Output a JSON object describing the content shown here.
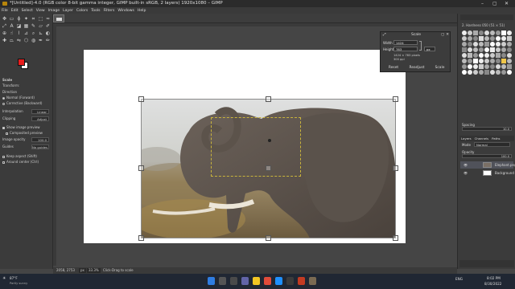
{
  "window": {
    "title": "*[Untitled]-4.0 (RGB color 8-bit gamma integer, GIMP built-in sRGB, 2 layers) 1920x1080 – GIMP"
  },
  "menu": [
    "File",
    "Edit",
    "Select",
    "View",
    "Image",
    "Layer",
    "Colors",
    "Tools",
    "Filters",
    "Windows",
    "Help"
  ],
  "colors": {
    "fg": "#e81d1d",
    "bg": "#ffffff",
    "accent": "#b8860b"
  },
  "tool_options": {
    "title": "Scale",
    "transform_label": "Transform:",
    "direction_label": "Direction",
    "normal": "Normal (Forward)",
    "corrective": "Corrective (Backward)",
    "interpolation_label": "Interpolation",
    "interpolation_value": "Linear",
    "clipping_label": "Clipping",
    "clipping_value": "Adjust",
    "show_preview": "Show image preview",
    "composited_preview": "Composited preview",
    "image_opacity_label": "Image opacity",
    "image_opacity_value": "100.0",
    "guides_label": "Guides",
    "guides_value": "No guides",
    "keep_aspect": "Keep aspect (Shift)",
    "around_center": "Around center (Ctrl)"
  },
  "scale_dialog": {
    "title": "Scale",
    "width_label": "Width",
    "width_value": "1424",
    "height_label": "Height",
    "height_value": "783",
    "unit": "px",
    "size_info": "1424 × 783 pixels",
    "resolution_info": "300 ppi",
    "reset": "Reset",
    "readjust": "Readjust",
    "scale": "Scale"
  },
  "brushes": {
    "header": "2. Hardness 050 (51 × 51)",
    "spacing_label": "Spacing",
    "spacing_value": "10.0"
  },
  "layers": {
    "tabs": [
      "Layers",
      "Channels",
      "Paths"
    ],
    "mode_label": "Mode",
    "mode_value": "Normal",
    "opacity_label": "Opacity",
    "opacity_value": "100.0",
    "lock_label": "Lock:",
    "items": [
      {
        "name": "Elephant.png"
      },
      {
        "name": "Background"
      }
    ]
  },
  "status": {
    "coords": "2058, 2753",
    "unit": "px",
    "zoom": "33.3%",
    "hint": "Click-Drag to scale"
  },
  "taskbar": {
    "temp": "87°F",
    "weather": "Partly sunny",
    "lang": "ENG",
    "time": "8:02 PM",
    "date": "8/30/2022"
  }
}
